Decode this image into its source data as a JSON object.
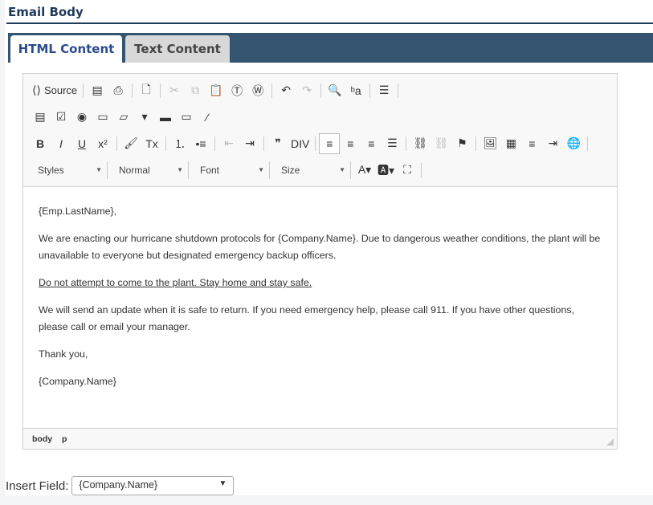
{
  "section_title": "Email Body",
  "tabs": [
    {
      "label": "HTML Content",
      "active": true
    },
    {
      "label": "Text Content",
      "active": false
    }
  ],
  "toolbar": {
    "rows": [
      [
        [
          {
            "icon": "source",
            "label": "Source"
          }
        ],
        [
          {
            "icon": "pdf"
          },
          {
            "icon": "print"
          }
        ],
        [
          {
            "icon": "new-page"
          }
        ],
        [
          {
            "icon": "cut",
            "disabled": true
          },
          {
            "icon": "copy",
            "disabled": true
          },
          {
            "icon": "paste"
          },
          {
            "icon": "paste-text"
          },
          {
            "icon": "paste-word"
          }
        ],
        [
          {
            "icon": "undo"
          },
          {
            "icon": "redo",
            "disabled": true
          }
        ],
        [
          {
            "icon": "find"
          },
          {
            "icon": "replace"
          }
        ],
        [
          {
            "icon": "show-blocks"
          }
        ]
      ],
      [
        [
          {
            "icon": "form"
          },
          {
            "icon": "checkbox"
          },
          {
            "icon": "radio"
          },
          {
            "icon": "text-field"
          },
          {
            "icon": "textarea"
          },
          {
            "icon": "select"
          },
          {
            "icon": "button"
          },
          {
            "icon": "image-button"
          },
          {
            "icon": "hidden-field"
          }
        ]
      ],
      [
        [
          {
            "icon": "bold"
          },
          {
            "icon": "italic"
          },
          {
            "icon": "underline"
          },
          {
            "icon": "superscript"
          }
        ],
        [
          {
            "icon": "copy-format"
          },
          {
            "icon": "remove-format"
          }
        ],
        [
          {
            "icon": "numbered-list"
          },
          {
            "icon": "bulleted-list"
          }
        ],
        [
          {
            "icon": "outdent",
            "disabled": true
          },
          {
            "icon": "indent"
          }
        ],
        [
          {
            "icon": "blockquote"
          },
          {
            "icon": "create-div"
          }
        ],
        [
          {
            "icon": "align-left",
            "active": true
          },
          {
            "icon": "align-center"
          },
          {
            "icon": "align-right"
          },
          {
            "icon": "justify"
          }
        ],
        [
          {
            "icon": "link"
          },
          {
            "icon": "unlink",
            "disabled": true
          },
          {
            "icon": "anchor"
          }
        ],
        [
          {
            "icon": "image"
          },
          {
            "icon": "table"
          },
          {
            "icon": "horizontal-line"
          },
          {
            "icon": "page-break"
          },
          {
            "icon": "iframe"
          }
        ]
      ]
    ],
    "combos": [
      "Styles",
      "Normal",
      "Font",
      "Size"
    ],
    "after_combos": [
      {
        "icon": "text-color"
      },
      {
        "icon": "background-color"
      },
      {
        "icon": "maximize"
      }
    ]
  },
  "content": {
    "greeting": "{Emp.LastName},",
    "p1": "We are enacting our hurricane shutdown protocols for {Company.Name}. Due to dangerous weather conditions, the plant will be unavailable to everyone but designated emergency backup officers.",
    "p2": "Do not attempt to come to the plant. Stay home and stay safe.",
    "p3": "We will send an update when it is safe to return. If you need emergency help, please call 911. If you have other questions, please call or email your manager.",
    "p4": "Thank you,",
    "p5": "{Company.Name}"
  },
  "statusbar": {
    "path": [
      "body",
      "p"
    ]
  },
  "insert_field": {
    "label": "Insert Field:",
    "value": "{Company.Name}"
  }
}
